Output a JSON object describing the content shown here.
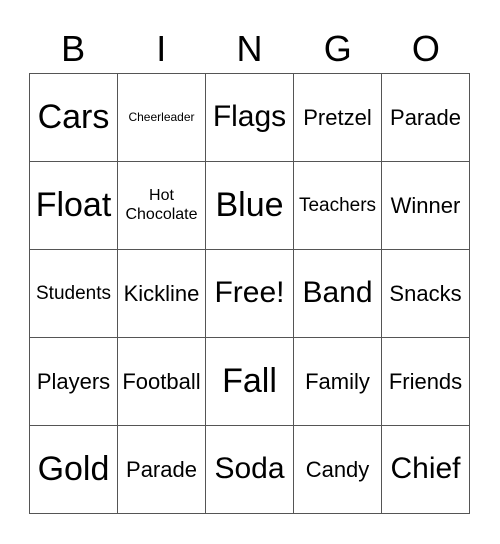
{
  "header": [
    "B",
    "I",
    "N",
    "G",
    "O"
  ],
  "cells": [
    {
      "text": "Cars",
      "size": "xl"
    },
    {
      "text": "Cheerleader",
      "size": "xxs"
    },
    {
      "text": "Flags",
      "size": "lg"
    },
    {
      "text": "Pretzel",
      "size": "md"
    },
    {
      "text": "Parade",
      "size": "md"
    },
    {
      "text": "Float",
      "size": "xl"
    },
    {
      "text": "Hot Chocolate",
      "size": "xs"
    },
    {
      "text": "Blue",
      "size": "xl"
    },
    {
      "text": "Teachers",
      "size": "sm"
    },
    {
      "text": "Winner",
      "size": "md"
    },
    {
      "text": "Students",
      "size": "sm"
    },
    {
      "text": "Kickline",
      "size": "md"
    },
    {
      "text": "Free!",
      "size": "lg"
    },
    {
      "text": "Band",
      "size": "lg"
    },
    {
      "text": "Snacks",
      "size": "md"
    },
    {
      "text": "Players",
      "size": "md"
    },
    {
      "text": "Football",
      "size": "md"
    },
    {
      "text": "Fall",
      "size": "xl"
    },
    {
      "text": "Family",
      "size": "md"
    },
    {
      "text": "Friends",
      "size": "md"
    },
    {
      "text": "Gold",
      "size": "xl"
    },
    {
      "text": "Parade",
      "size": "md"
    },
    {
      "text": "Soda",
      "size": "lg"
    },
    {
      "text": "Candy",
      "size": "md"
    },
    {
      "text": "Chief",
      "size": "lg"
    }
  ]
}
